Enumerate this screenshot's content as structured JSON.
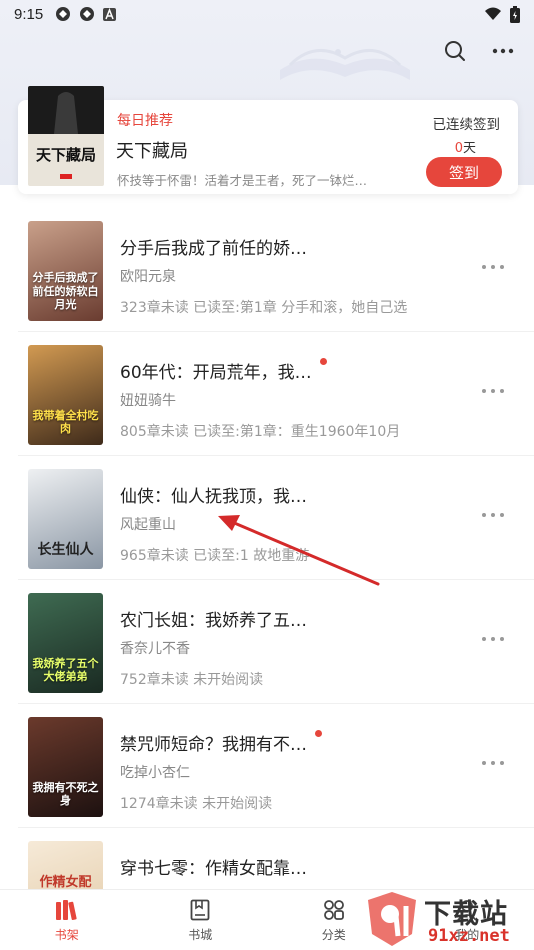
{
  "status_bar": {
    "time": "9:15"
  },
  "recommend": {
    "tag": "每日推荐",
    "cover_text": "天下藏局",
    "title": "天下藏局",
    "desc": "怀技等于怀雷！活着才是王者，死了一钵烂…",
    "sign_status": "已连续签到",
    "sign_days_num": "0",
    "sign_days_unit": "天",
    "sign_button": "签到"
  },
  "books": [
    {
      "title": "分手后我成了前任的娇…",
      "author": "欧阳元泉",
      "progress": "323章未读 已读至:第1章 分手和滚，她自己选",
      "cover_text": "分手后我成了前任的娇软白月光",
      "unread_dot": false,
      "cover_color": "#8a5a48"
    },
    {
      "title": "60年代：开局荒年，我…",
      "author": "妞妞骑牛",
      "progress": "805章未读 已读至:第1章：重生1960年10月",
      "cover_text": "我带着全村吃肉",
      "unread_dot": true,
      "cover_color": "#6e4a2c"
    },
    {
      "title": "仙侠：仙人抚我顶，我…",
      "author": "风起重山",
      "progress": "965章未读 已读至:1 故地重游",
      "cover_text": "长生仙人",
      "unread_dot": false,
      "cover_color": "#c9cdd3"
    },
    {
      "title": "农门长姐：我娇养了五…",
      "author": "香奈儿不香",
      "progress": "752章未读 未开始阅读",
      "cover_text": "我娇养了五个大佬弟弟",
      "unread_dot": false,
      "cover_color": "#2f4a3a"
    },
    {
      "title": "禁咒师短命？我拥有不…",
      "author": "吃掉小杏仁",
      "progress": "1274章未读 未开始阅读",
      "cover_text": "我拥有不死之身",
      "unread_dot": true,
      "cover_color": "#3a2420"
    },
    {
      "title": "穿书七零：作精女配靠…",
      "author": "",
      "progress": "",
      "cover_text": "作精女配",
      "unread_dot": false,
      "cover_color": "#f1e3cf"
    }
  ],
  "tabs": [
    {
      "label": "书架",
      "active": true
    },
    {
      "label": "书城",
      "active": false
    },
    {
      "label": "分类",
      "active": false
    },
    {
      "label": "我的",
      "active": false
    }
  ],
  "watermark": {
    "brand": "下载站",
    "url": "91xz.net"
  },
  "colors": {
    "accent": "#e6463c",
    "header_bg": "#e9ecf4",
    "text_muted": "#999999"
  }
}
